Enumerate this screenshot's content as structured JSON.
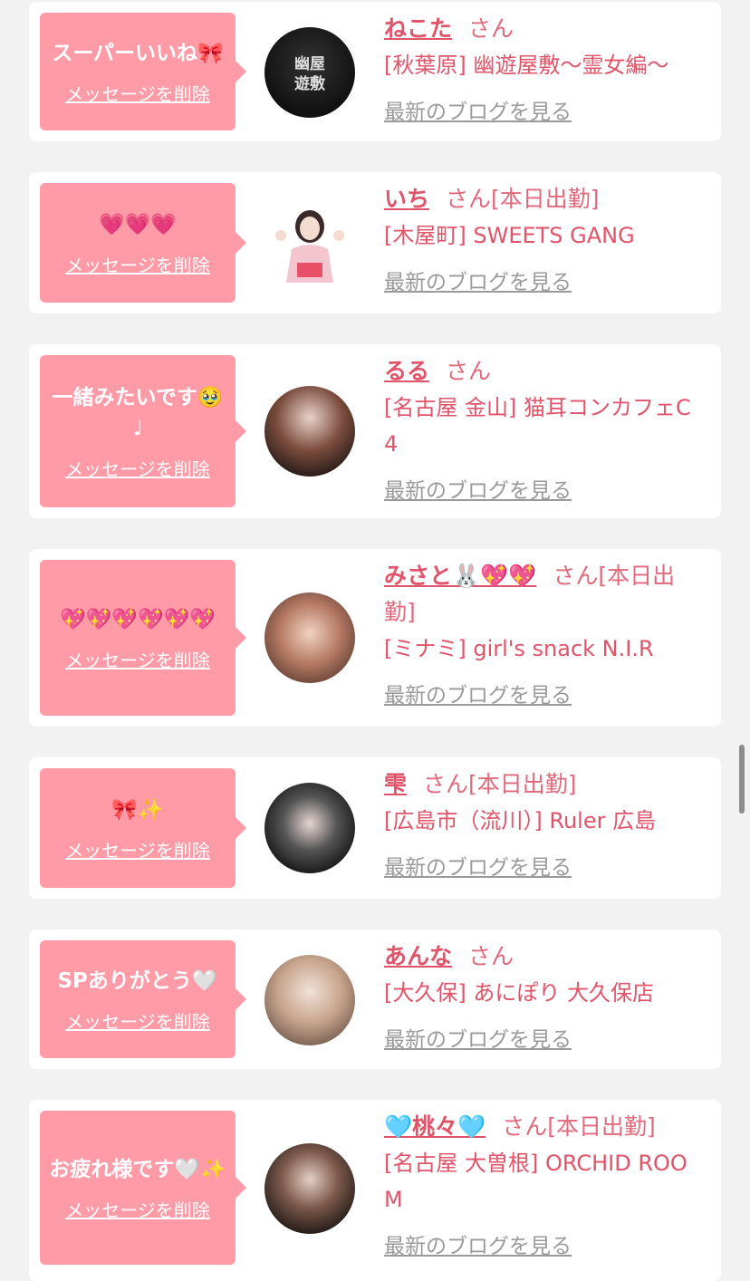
{
  "delete_label": "メッセージを削除",
  "san_label": "さん",
  "blog_link_label": "最新のブログを見る",
  "colors": {
    "background": "#f2f2f2",
    "card": "#ffffff",
    "bubble": "#ff9aa7",
    "accent": "#e0546a",
    "link_gray": "#9a9a9a"
  },
  "items": [
    {
      "message": "スーパーいいね🎀",
      "name": "ねこた",
      "status": "",
      "shop": "[秋葉原] 幽遊屋敷〜霊女編〜",
      "avatar_icon": "shop-logo-avatar",
      "avatar_text": "幽屋 遊敷"
    },
    {
      "message": "💗💗💗",
      "name": "いち",
      "status": "[本日出勤]",
      "shop": "[木屋町] SWEETS GANG",
      "avatar_icon": "girl-cutout-avatar",
      "avatar_text": ""
    },
    {
      "message": "一緒みたいです🥹♩",
      "name": "るる",
      "status": "",
      "shop": "[名古屋 金山] 猫耳コンカフェC4",
      "avatar_icon": "profile-photo-avatar",
      "avatar_text": ""
    },
    {
      "message": "💖💖💖💖💖💖",
      "name": "みさと🐰💖💖",
      "status": "[本日出勤]",
      "shop": "[ミナミ] girl's snack N.I.R",
      "avatar_icon": "profile-photo-avatar",
      "avatar_text": ""
    },
    {
      "message": "🎀✨",
      "name": "雫",
      "status": "[本日出勤]",
      "shop": "[広島市（流川）] Ruler 広島",
      "avatar_icon": "profile-photo-avatar",
      "avatar_text": ""
    },
    {
      "message": "SPありがとう🤍",
      "name": "あんな",
      "status": "",
      "shop": "[大久保] あにぽり 大久保店",
      "avatar_icon": "profile-photo-avatar",
      "avatar_text": ""
    },
    {
      "message": "お疲れ様です🤍✨",
      "name": "🩵桃々🩵",
      "status": "[本日出勤]",
      "shop": "[名古屋 大曽根] ORCHID ROOM",
      "avatar_icon": "profile-photo-avatar",
      "avatar_text": ""
    }
  ]
}
